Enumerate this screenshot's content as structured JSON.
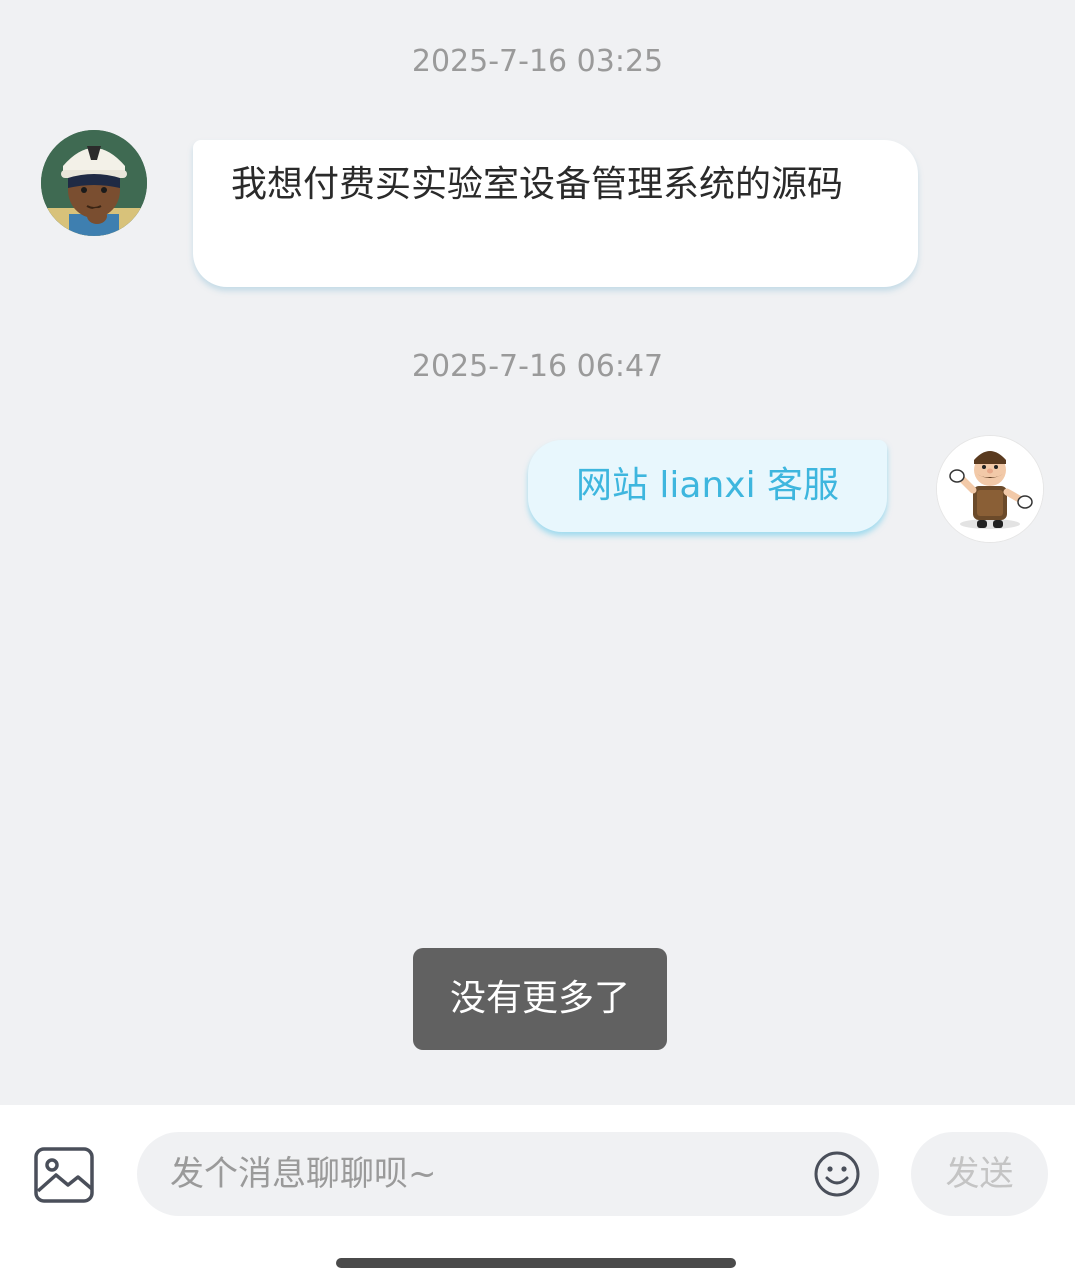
{
  "messages": [
    {
      "timestamp": "2025-7-16 03:25",
      "side": "left",
      "text": "我想付费买实验室设备管理系统的源码",
      "avatar": "user-avatar-cartoon-boy"
    },
    {
      "timestamp": "2025-7-16 06:47",
      "side": "right",
      "text": "网站 lianxi 客服",
      "avatar": "agent-avatar-cartoon-man"
    }
  ],
  "toast": {
    "text": "没有更多了"
  },
  "input_bar": {
    "placeholder": "发个消息聊聊呗~",
    "value": "",
    "send_label": "发送",
    "image_icon": "image-icon",
    "emoji_icon": "smiley-icon"
  },
  "colors": {
    "background": "#f0f1f3",
    "agent_bubble": "#e8f7fd",
    "agent_text": "#3eb6de",
    "toast_bg": "#616161"
  }
}
